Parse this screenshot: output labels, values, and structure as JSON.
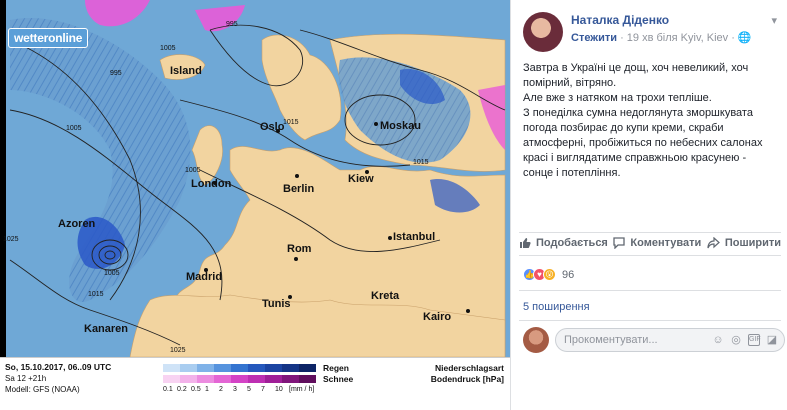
{
  "map": {
    "brand": "wetteronline",
    "cities": [
      {
        "name": "Island"
      },
      {
        "name": "Oslo"
      },
      {
        "name": "Moskau"
      },
      {
        "name": "London"
      },
      {
        "name": "Berlin"
      },
      {
        "name": "Kiew"
      },
      {
        "name": "Azoren"
      },
      {
        "name": "Rom"
      },
      {
        "name": "Istanbul"
      },
      {
        "name": "Madrid"
      },
      {
        "name": "Tunis"
      },
      {
        "name": "Kreta"
      },
      {
        "name": "Kanaren"
      },
      {
        "name": "Kairo"
      }
    ],
    "isobars": [
      "995",
      "1005",
      "995",
      "1005",
      "1005",
      "1015",
      "1025",
      "1015",
      "1005",
      "1015",
      "1025"
    ],
    "footer": {
      "date": "So, 15.10.2017, 06..09 UTC",
      "run": "Sa 12 +21h",
      "model": "Modell: GFS (NOAA)",
      "rain_label": "Regen",
      "snow_label": "Schnee",
      "scale_values": [
        "0.1",
        "0.2",
        "0.5",
        "1",
        "2",
        "3",
        "5",
        "7",
        "10",
        "[mm / h]"
      ],
      "precip": "Niederschlagsart",
      "pressure": "Bodendruck [hPa]"
    },
    "colors": {
      "sea": "#6fa8d6",
      "land": "#f2d4a0",
      "rain_dark": "#1a3fae",
      "snow": "#e85ad8"
    }
  },
  "post": {
    "author": "Наталка Діденко",
    "follow": "Стежити",
    "meta": "· 19 хв біля Kyiv, Kiev ·",
    "paragraphs": [
      "Завтра в Україні це дощ, хоч невеликий, хоч помірний, вітряно.",
      "Але вже з натяком на трохи тепліше.",
      "З понеділка сумна недоглянута зморшкувата погода позбирає до купи креми, скраби атмосферні, пробіжиться по небесних салонах красі і виглядатиме справжньою красунею - сонце і потепління."
    ],
    "actions": {
      "like": "Подобається",
      "comment": "Коментувати",
      "share": "Поширити"
    },
    "reactions_count": "96",
    "shares": "5 поширення",
    "comment_placeholder": "Прокоментувати...",
    "accent": "#365899"
  }
}
